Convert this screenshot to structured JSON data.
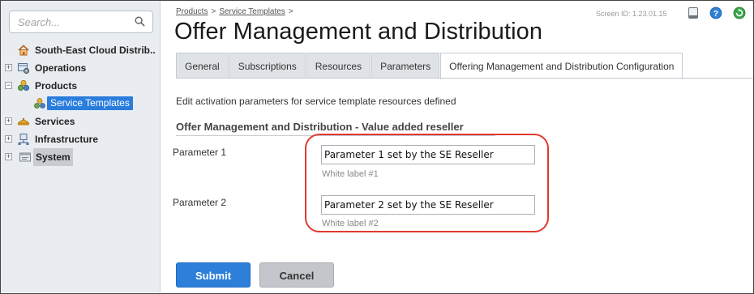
{
  "sidebar": {
    "search_placeholder": "Search...",
    "tree": [
      {
        "label": "South-East Cloud Distrib..",
        "icon": "home-icon"
      },
      {
        "label": "Operations",
        "icon": "operations-icon",
        "expander": "+"
      },
      {
        "label": "Products",
        "icon": "products-icon",
        "expander": "−"
      },
      {
        "label": "Service Templates",
        "icon": "service-templates-icon"
      },
      {
        "label": "Services",
        "icon": "services-icon",
        "expander": "+"
      },
      {
        "label": "Infrastructure",
        "icon": "infrastructure-icon",
        "expander": "+"
      },
      {
        "label": "System",
        "icon": "system-icon",
        "expander": "+"
      }
    ]
  },
  "header": {
    "breadcrumb": [
      "Products",
      "Service Templates"
    ],
    "breadcrumb_sep": ">",
    "screen_id": "Screen ID:  1.23.01.15",
    "title": "Offer Management and Distribution"
  },
  "tabs": [
    {
      "label": "General"
    },
    {
      "label": "Subscriptions"
    },
    {
      "label": "Resources"
    },
    {
      "label": "Parameters"
    },
    {
      "label": "Offering Management and Distribution Configuration",
      "active": true
    }
  ],
  "content": {
    "description": "Edit activation parameters for service template resources defined",
    "section_title": "Offer Management and Distribution - Value added reseller",
    "params": [
      {
        "label": "Parameter 1",
        "value": "Parameter 1 set by the SE Reseller",
        "hint": "White label #1"
      },
      {
        "label": "Parameter 2",
        "value": "Parameter 2 set by the SE Reseller",
        "hint": "White label #2"
      }
    ]
  },
  "actions": {
    "submit_label": "Submit",
    "cancel_label": "Cancel"
  },
  "colors": {
    "accent": "#2e7fd9",
    "highlight": "#e0392f",
    "selected": "#2a7ddc"
  }
}
